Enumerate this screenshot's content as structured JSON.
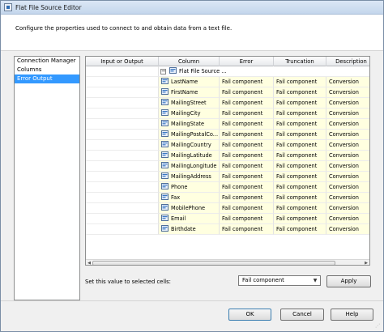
{
  "window": {
    "title": "Flat File Source Editor"
  },
  "header": {
    "description": "Configure the properties used to connect to and obtain data from a text file."
  },
  "nav": {
    "items": [
      {
        "label": "Connection Manager",
        "selected": false
      },
      {
        "label": "Columns",
        "selected": false
      },
      {
        "label": "Error Output",
        "selected": true
      }
    ]
  },
  "grid": {
    "headers": [
      "Input or Output",
      "Column",
      "Error",
      "Truncation",
      "Description"
    ],
    "group": {
      "label": "Flat File Source ...",
      "expander": "−"
    },
    "rows": [
      {
        "column": "LastName",
        "error": "Fail component",
        "truncation": "Fail component",
        "description": "Conversion"
      },
      {
        "column": "FirstName",
        "error": "Fail component",
        "truncation": "Fail component",
        "description": "Conversion"
      },
      {
        "column": "MailingStreet",
        "error": "Fail component",
        "truncation": "Fail component",
        "description": "Conversion"
      },
      {
        "column": "MailingCity",
        "error": "Fail component",
        "truncation": "Fail component",
        "description": "Conversion"
      },
      {
        "column": "MailingState",
        "error": "Fail component",
        "truncation": "Fail component",
        "description": "Conversion"
      },
      {
        "column": "MailingPostalCo...",
        "error": "Fail component",
        "truncation": "Fail component",
        "description": "Conversion"
      },
      {
        "column": "MailingCountry",
        "error": "Fail component",
        "truncation": "Fail component",
        "description": "Conversion"
      },
      {
        "column": "MailingLatitude",
        "error": "Fail component",
        "truncation": "Fail component",
        "description": "Conversion"
      },
      {
        "column": "MailingLongitude",
        "error": "Fail component",
        "truncation": "Fail component",
        "description": "Conversion"
      },
      {
        "column": "MailingAddress",
        "error": "Fail component",
        "truncation": "Fail component",
        "description": "Conversion"
      },
      {
        "column": "Phone",
        "error": "Fail component",
        "truncation": "Fail component",
        "description": "Conversion"
      },
      {
        "column": "Fax",
        "error": "Fail component",
        "truncation": "Fail component",
        "description": "Conversion"
      },
      {
        "column": "MobilePhone",
        "error": "Fail component",
        "truncation": "Fail component",
        "description": "Conversion"
      },
      {
        "column": "Email",
        "error": "Fail component",
        "truncation": "Fail component",
        "description": "Conversion"
      },
      {
        "column": "Birthdate",
        "error": "Fail component",
        "truncation": "Fail component",
        "description": "Conversion"
      }
    ]
  },
  "footer": {
    "set_value_label": "Set this value to selected cells:",
    "select_value": "Fail component",
    "apply_label": "Apply",
    "ok_label": "OK",
    "cancel_label": "Cancel",
    "help_label": "Help"
  },
  "colors": {
    "row_highlight": "#ffffe0",
    "selection": "#3399ff"
  },
  "icons": {
    "window": "ssis-editor-icon",
    "column": "column-icon",
    "output": "output-icon"
  }
}
